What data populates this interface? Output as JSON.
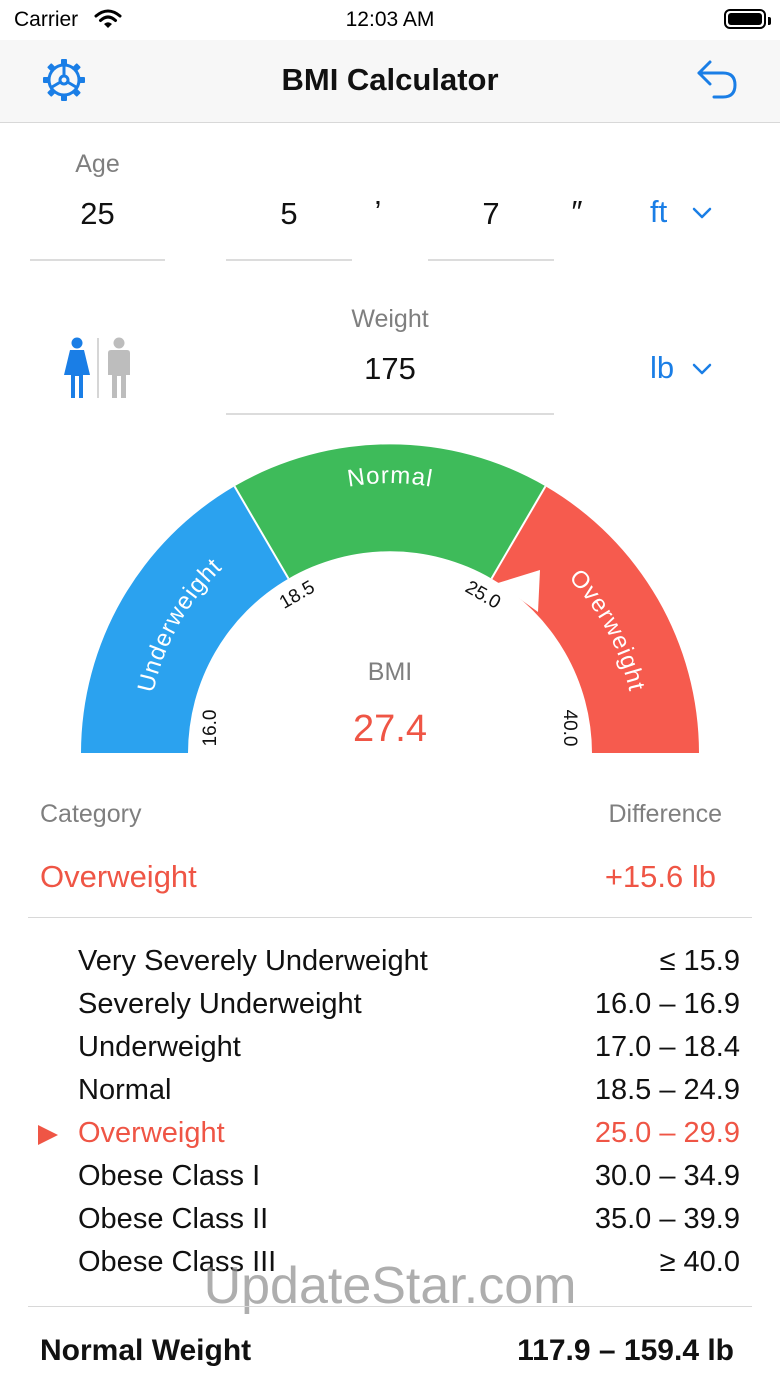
{
  "status_bar": {
    "carrier": "Carrier",
    "time": "12:03 AM"
  },
  "nav": {
    "title": "BMI Calculator",
    "left_icon": "gear-icon",
    "right_icon": "undo-arrow-icon"
  },
  "inputs": {
    "age_label": "Age",
    "age_value": "25",
    "height_feet": "5",
    "feet_mark": "’",
    "height_inches": "7",
    "inch_mark": "″",
    "height_unit": "ft",
    "weight_label": "Weight",
    "weight_value": "175",
    "weight_unit": "lb"
  },
  "gender": {
    "selected": "female"
  },
  "gauge": {
    "segments": [
      {
        "label": "Underweight",
        "color": "#2ba2ef"
      },
      {
        "label": "Normal",
        "color": "#3ebb5a"
      },
      {
        "label": "Overweight",
        "color": "#f65b4e"
      }
    ],
    "ticks": [
      "16.0",
      "18.5",
      "25.0",
      "40.0"
    ],
    "bmi_label": "BMI",
    "bmi_value": "27.4"
  },
  "result": {
    "category_label": "Category",
    "difference_label": "Difference",
    "category": "Overweight",
    "difference": "+15.6 lb"
  },
  "table": [
    {
      "name": "Very Severely Underweight",
      "range": "≤ 15.9",
      "active": false
    },
    {
      "name": "Severely Underweight",
      "range": "16.0 – 16.9",
      "active": false
    },
    {
      "name": "Underweight",
      "range": "17.0 – 18.4",
      "active": false
    },
    {
      "name": "Normal",
      "range": "18.5 – 24.9",
      "active": false
    },
    {
      "name": "Overweight",
      "range": "25.0 – 29.9",
      "active": true
    },
    {
      "name": "Obese Class I",
      "range": "30.0 – 34.9",
      "active": false
    },
    {
      "name": "Obese Class II",
      "range": "35.0 – 39.9",
      "active": false
    },
    {
      "name": "Obese Class III",
      "range": "≥ 40.0",
      "active": false
    }
  ],
  "normal_weight": {
    "label": "Normal Weight",
    "value": "117.9 – 159.4 lb"
  },
  "watermark": "UpdateStar.com",
  "colors": {
    "accent": "#1a7ee6",
    "alert": "#ef5545"
  }
}
